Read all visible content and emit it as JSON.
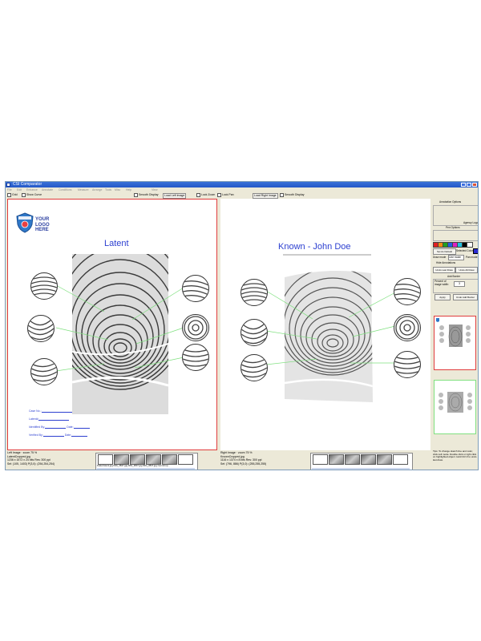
{
  "window": {
    "title": "CSI Comparator"
  },
  "menu": [
    "File",
    "Edit",
    "Enhance",
    "Annotate",
    "Conditions",
    "Measure",
    "Arrange",
    "Tools",
    "Misc",
    "Help",
    "View"
  ],
  "toolbar": {
    "grid": "Grid",
    "show_curve": "Show Curve",
    "smooth_display_left": "Smooth Display",
    "load_left": "Load Left Image",
    "lock_zoom": "Lock Zoom",
    "lock_pan": "Lock Pan",
    "load_right": "Load Right Image",
    "smooth_display_right": "Smooth Display"
  },
  "left_panel": {
    "logo_text": "YOUR LOGO HERE",
    "heading": "Latent",
    "form": {
      "case_no": "Case No.:",
      "latent": "Latent#",
      "identified_by": "Identified By:",
      "date1": "Date:",
      "verified_by": "Verified By:",
      "date2": "Date:"
    }
  },
  "right_panel": {
    "heading": "Known - John Doe"
  },
  "status_left": {
    "line1": "Left Image · zoom 75 %",
    "line2": "LatentCropped.jpg",
    "line3": "1236 x 1572 x 24 bits    Res: 300 ppi",
    "line4": "Sel: (105, 1403)    P(3,0): (254,254,254)"
  },
  "status_right": {
    "line1": "Right Image · zoom 75 %",
    "line2": "KnownCropped.jpg",
    "line3": "1116 x 1374 x 8 bits    Res: 300 ppi",
    "line4": "Sel: (796, 886)    P(3,0): (255,255,255)"
  },
  "strip_left": {
    "names": "Failed.latent.jpg  IMG_3847.jpg  IMG_3847.jpg  IMG_3847.jpg  zoomCrop..."
  },
  "side_panel": {
    "annotation_options": "Annotation Options",
    "pen_options": "Pen Options",
    "agency_logo": "Agency Logo",
    "set_as_default": "Set As Default",
    "selected_color": "Selected Color",
    "draw_mode": "Draw mode",
    "draw_mode_value": "Line mode",
    "pan_mode": "Pan mode",
    "hide_annotations": "Hide Annotations",
    "undo_last_draw": "Undo Last Draw",
    "undo_all_draw": "Undo All Draw",
    "add_border": "Add Border",
    "percent_label": "Percent of image width:",
    "percent_value": "3",
    "apply": "Apply",
    "undo_add_border": "Undo Add Border",
    "tips": "Tips: To change sketch line and color, click cell mode. Double click or right click on highlighted object. Hold Ctrl Z to undo last draw.",
    "swatch_colors": [
      "#e02020",
      "#f08a10",
      "#20a020",
      "#2060e0",
      "#e020c0",
      "#20c0e0",
      "#000000",
      "#ffffff",
      "#2a2ad0"
    ]
  }
}
